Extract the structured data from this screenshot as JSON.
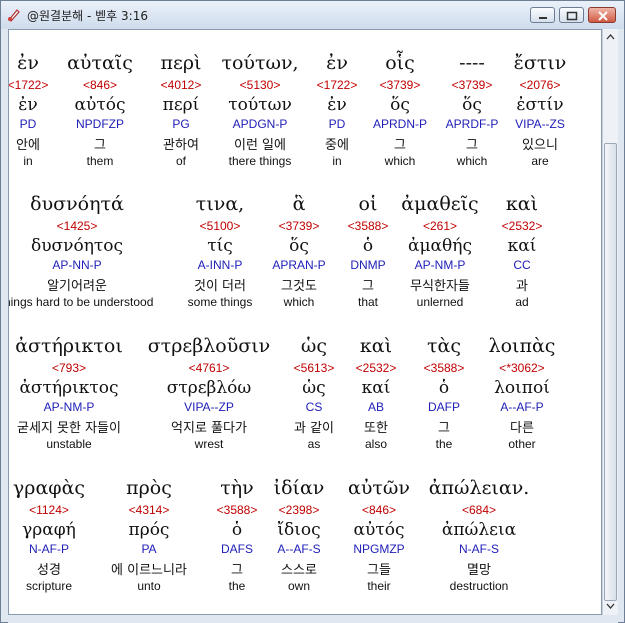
{
  "window": {
    "title": "@원결분해 - 벧후 3:16"
  },
  "colors": {
    "strong": "#c00000",
    "parse": "#2020b8",
    "text": "#111111"
  },
  "rows": [
    [
      {
        "greek": "ἐν",
        "strong": "<1722>",
        "lemma": "ἐν",
        "parse": "PD",
        "korean": "안에",
        "english": "in"
      },
      {
        "greek": "αὐταῖς",
        "strong": "<846>",
        "lemma": "αὐτός",
        "parse": "NPDFZP",
        "korean": "그",
        "english": "them"
      },
      {
        "greek": "περὶ",
        "strong": "<4012>",
        "lemma": "περί",
        "parse": "PG",
        "korean": "관하여",
        "english": "of"
      },
      {
        "greek": "τούτων,",
        "strong": "<5130>",
        "lemma": "τούτων",
        "parse": "APDGN-P",
        "korean": "이런 일에",
        "english": "there things"
      },
      {
        "greek": "ἐν",
        "strong": "<1722>",
        "lemma": "ἐν",
        "parse": "PD",
        "korean": "중에",
        "english": "in"
      },
      {
        "greek": "οἷς",
        "strong": "<3739>",
        "lemma": "ὅς",
        "parse": "APRDN-P",
        "korean": "그",
        "english": "which"
      },
      {
        "greek": "----",
        "strong": "<3739>",
        "lemma": "ὅς",
        "parse": "APRDF-P",
        "korean": "그",
        "english": "which"
      },
      {
        "greek": "ἔστιν",
        "strong": "<2076>",
        "lemma": "ἐστίν",
        "parse": "VIPA--ZS",
        "korean": "있으니",
        "english": "are"
      }
    ],
    [
      {
        "greek": "δυσνόητά",
        "strong": "<1425>",
        "lemma": "δυσνόητος",
        "parse": "AP-NN-P",
        "korean": "알기어려운",
        "english": "things hard to be understood"
      },
      {
        "greek": "τινα,",
        "strong": "<5100>",
        "lemma": "τίς",
        "parse": "A-INN-P",
        "korean": "것이 더러",
        "english": "some things"
      },
      {
        "greek": "ἃ",
        "strong": "<3739>",
        "lemma": "ὅς",
        "parse": "APRAN-P",
        "korean": "그것도",
        "english": "which"
      },
      {
        "greek": "οἱ",
        "strong": "<3588>",
        "lemma": "ὁ",
        "parse": "DNMP",
        "korean": "그",
        "english": "that"
      },
      {
        "greek": "ἀμαθεῖς",
        "strong": "<261>",
        "lemma": "ἀμαθής",
        "parse": "AP-NM-P",
        "korean": "무식한자들",
        "english": "unlerned"
      },
      {
        "greek": "καὶ",
        "strong": "<2532>",
        "lemma": "καί",
        "parse": "CC",
        "korean": "과",
        "english": "ad"
      }
    ],
    [
      {
        "greek": "ἀστήρικτοι",
        "strong": "<793>",
        "lemma": "ἀστήρικτος",
        "parse": "AP-NM-P",
        "korean": "굳세지 못한 자들이",
        "english": "unstable"
      },
      {
        "greek": "στρεβλοῦσιν",
        "strong": "<4761>",
        "lemma": "στρεβλόω",
        "parse": "VIPA--ZP",
        "korean": "억지로 풀다가",
        "english": "wrest"
      },
      {
        "greek": "ὡς",
        "strong": "<5613>",
        "lemma": "ὡς",
        "parse": "CS",
        "korean": "과 같이",
        "english": "as"
      },
      {
        "greek": "καὶ",
        "strong": "<2532>",
        "lemma": "καί",
        "parse": "AB",
        "korean": "또한",
        "english": "also"
      },
      {
        "greek": "τὰς",
        "strong": "<3588>",
        "lemma": "ὁ",
        "parse": "DAFP",
        "korean": "그",
        "english": "the"
      },
      {
        "greek": "λοιπὰς",
        "strong": "<*3062>",
        "lemma": "λοιποί",
        "parse": "A--AF-P",
        "korean": "다른",
        "english": "other"
      }
    ],
    [
      {
        "greek": "γραφὰς",
        "strong": "<1124>",
        "lemma": "γραφή",
        "parse": "N-AF-P",
        "korean": "성경",
        "english": "scripture"
      },
      {
        "greek": "πρὸς",
        "strong": "<4314>",
        "lemma": "πρός",
        "parse": "PA",
        "korean": "에 이르느니라",
        "english": "unto"
      },
      {
        "greek": "τὴν",
        "strong": "<3588>",
        "lemma": "ὁ",
        "parse": "DAFS",
        "korean": "그",
        "english": "the"
      },
      {
        "greek": "ἰδίαν",
        "strong": "<2398>",
        "lemma": "ἴδιος",
        "parse": "A--AF-S",
        "korean": "스스로",
        "english": "own"
      },
      {
        "greek": "αὐτῶν",
        "strong": "<846>",
        "lemma": "αὐτός",
        "parse": "NPGMZP",
        "korean": "그들",
        "english": "their"
      },
      {
        "greek": "ἀπώλειαν.",
        "strong": "<684>",
        "lemma": "ἀπώλεια",
        "parse": "N-AF-S",
        "korean": "멸망",
        "english": "destruction"
      }
    ]
  ]
}
